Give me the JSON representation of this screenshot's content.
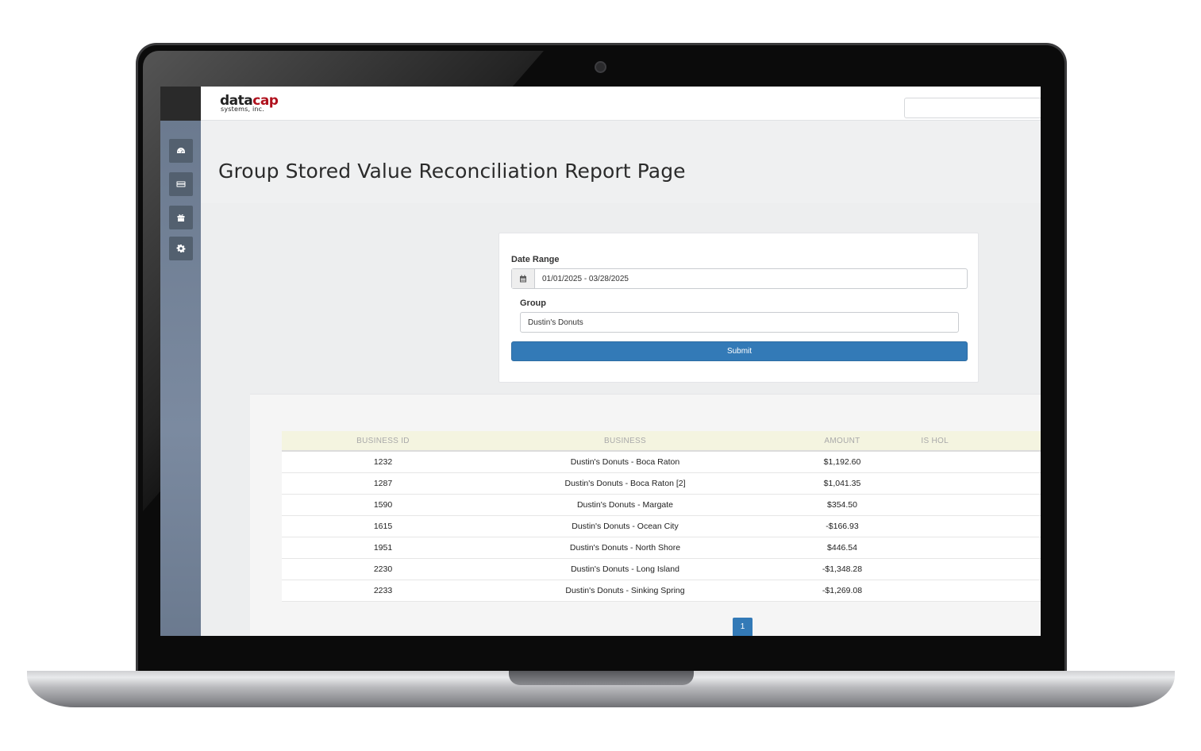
{
  "app": {
    "logo_main_dark": "data",
    "logo_main_red": "cap",
    "logo_sub": "systems, inc."
  },
  "sidebar": {
    "items": [
      {
        "icon": "dashboard-icon"
      },
      {
        "icon": "credit-card-icon"
      },
      {
        "icon": "gift-icon"
      },
      {
        "icon": "gear-icon"
      }
    ]
  },
  "page": {
    "title": "Group Stored Value Reconciliation Report Page"
  },
  "form": {
    "date_label": "Date Range",
    "date_value": "01/01/2025 - 03/28/2025",
    "group_label": "Group",
    "group_value": "Dustin's Donuts",
    "submit_label": "Submit"
  },
  "report": {
    "columns": [
      "BUSINESS ID",
      "BUSINESS",
      "AMOUNT",
      "IS HOL"
    ],
    "rows": [
      {
        "id": "1232",
        "business": "Dustin's Donuts - Boca Raton",
        "amount": "$1,192.60"
      },
      {
        "id": "1287",
        "business": "Dustin's Donuts - Boca Raton [2]",
        "amount": "$1,041.35"
      },
      {
        "id": "1590",
        "business": "Dustin's Donuts - Margate",
        "amount": "$354.50"
      },
      {
        "id": "1615",
        "business": "Dustin's Donuts - Ocean City",
        "amount": "-$166.93"
      },
      {
        "id": "1951",
        "business": "Dustin's Donuts - North Shore",
        "amount": "$446.54"
      },
      {
        "id": "2230",
        "business": "Dustin's Donuts - Long Island",
        "amount": "-$1,348.28"
      },
      {
        "id": "2233",
        "business": "Dustin's Donuts - Sinking Spring",
        "amount": "-$1,269.08"
      }
    ],
    "current_page": "1"
  },
  "colors": {
    "primary": "#337ab7",
    "sidebar": "#7b8aa0",
    "header_row": "#f4f4e0",
    "brand_red": "#b0111d"
  }
}
